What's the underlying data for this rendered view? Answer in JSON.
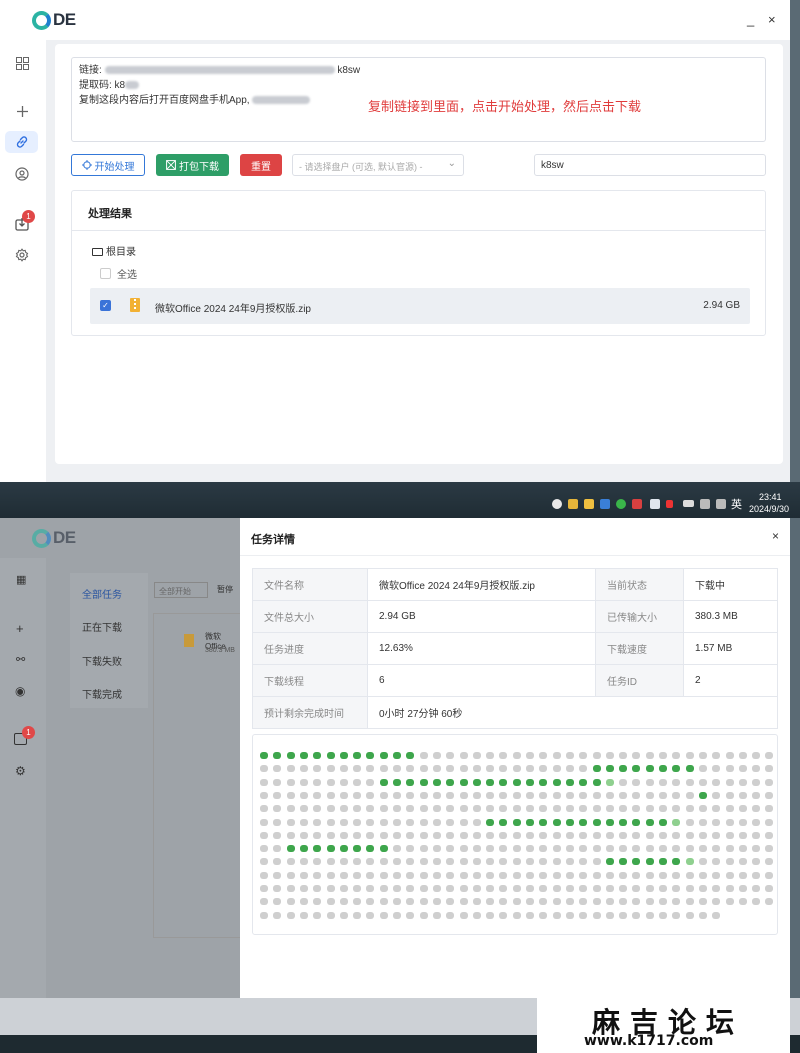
{
  "top_window": {
    "logo": "DE",
    "window_controls": {
      "minimize": "_",
      "close": "×"
    },
    "sidebar_icons": [
      "grid-icon",
      "plus-icon",
      "link-icon",
      "user-icon",
      "download-icon",
      "gear-icon"
    ],
    "download_badge": "1",
    "link_box": {
      "line1_label": "链接:",
      "line1_suffix": "k8sw",
      "line2_label": "提取码: k8",
      "line3_label": "复制这段内容后打开百度网盘手机App,"
    },
    "instruction": "复制链接到里面，点击开始处理，然后点击下载",
    "buttons": {
      "start": "开始处理",
      "pack_download": "打包下载",
      "reset": "重置"
    },
    "select_disk_placeholder": "- 请选择盘户 (可选, 默认官源) -",
    "code_input_value": "k8sw",
    "result": {
      "title": "处理结果",
      "root_dir": "根目录",
      "select_all": "全选",
      "file_name": "微软Office 2024 24年9月授权版.zip",
      "file_size": "2.94 GB"
    }
  },
  "taskbar": {
    "ime": "英",
    "time": "23:41",
    "date": "2024/9/30"
  },
  "bottom_window": {
    "logo": "DE",
    "sidebar_tabs": [
      "全部任务",
      "正在下载",
      "下载失败",
      "下载完成"
    ],
    "toolbar_fragments": [
      "全部开始",
      "暂停"
    ],
    "task_preview_name": "微软Office",
    "task_preview_size": "380.3 MB",
    "drawer": {
      "title": "任务详情",
      "close": "×",
      "rows": [
        {
          "k1": "文件名称",
          "v1": "微软Office 2024 24年9月授权版.zip",
          "k2": "当前状态",
          "v2": "下载中"
        },
        {
          "k1": "文件总大小",
          "v1": "2.94 GB",
          "k2": "已传输大小",
          "v2": "380.3 MB"
        },
        {
          "k1": "任务进度",
          "v1": "12.63%",
          "k2": "下载速度",
          "v2": "1.57 MB"
        },
        {
          "k1": "下载线程",
          "v1": "6",
          "k2": "任务ID",
          "v2": "2"
        },
        {
          "k1": "预计剩余完成时间",
          "v1": "0小时 27分钟 60秒"
        }
      ],
      "chunk_progress": {
        "rows": 13,
        "row_lengths": [
          39,
          39,
          39,
          39,
          39,
          39,
          39,
          39,
          39,
          39,
          39,
          39,
          35
        ],
        "done_ranges": [
          [
            0,
            0,
            11
          ],
          [
            1,
            25,
            32
          ],
          [
            2,
            9,
            25
          ],
          [
            3,
            33,
            33
          ],
          [
            5,
            17,
            30
          ],
          [
            7,
            2,
            9
          ],
          [
            8,
            26,
            31
          ]
        ],
        "partial_cells": [
          [
            2,
            26
          ],
          [
            5,
            31
          ],
          [
            8,
            32
          ]
        ]
      }
    }
  },
  "watermark": {
    "title": "麻吉论坛",
    "url": "www.k1717.com"
  }
}
